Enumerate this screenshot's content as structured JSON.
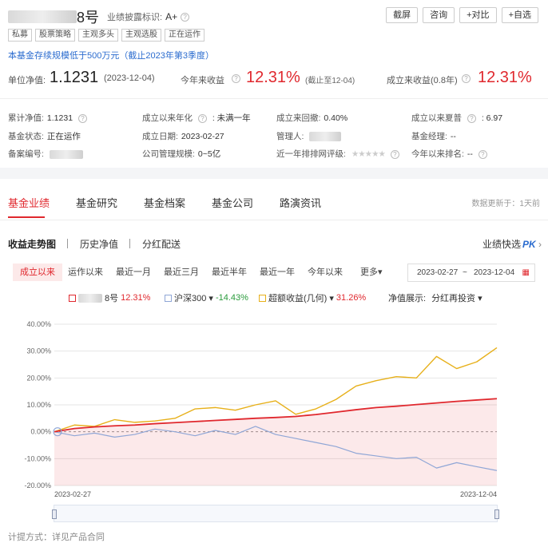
{
  "header": {
    "fund_name_visible": "8号",
    "disclosure_label": "业绩披露标识:",
    "disclosure_value": "A+",
    "buttons": [
      "截屏",
      "咨询",
      "+对比",
      "+自选"
    ],
    "tags": [
      "私募",
      "股票策略",
      "主观多头",
      "主观选股",
      "正在运作"
    ],
    "notice": "本基金存续规模低于500万元（截止2023年第3季度）"
  },
  "nav": {
    "unit_nav_label": "单位净值:",
    "unit_nav_value": "1.1231",
    "unit_nav_date": "(2023-12-04)",
    "ytd_label": "今年来收益",
    "ytd_value": "12.31%",
    "ytd_note": "(截止至12-04)",
    "since_label": "成立来收益(0.8年)",
    "since_value": "12.31%"
  },
  "info": [
    {
      "label": "累计净值:",
      "value": "1.1231"
    },
    {
      "label": "成立以来年化",
      "value": ": 未满一年"
    },
    {
      "label": "成立来回撤:",
      "value": "0.40%"
    },
    {
      "label": "成立以来夏普",
      "value": ": 6.97"
    },
    {
      "label": "基金状态:",
      "value": "正在运作"
    },
    {
      "label": "成立日期:",
      "value": "2023-02-27"
    },
    {
      "label": "管理人:",
      "value": ""
    },
    {
      "label": "基金经理:",
      "value": "--"
    },
    {
      "label": "备案编号:",
      "value": ""
    },
    {
      "label": "公司管理规模:",
      "value": "0~5亿"
    },
    {
      "label": "近一年排排网评级:",
      "value": "★★★★★"
    },
    {
      "label": "今年以来排名:",
      "value": "--"
    }
  ],
  "tabs": [
    "基金业绩",
    "基金研究",
    "基金档案",
    "基金公司",
    "路演资讯"
  ],
  "update_note": "数据更新于：1天前",
  "subtabs": [
    "收益走势图",
    "历史净值",
    "分红配送"
  ],
  "pk_label": "业绩快选",
  "pk_badge": "PK",
  "ranges": [
    "成立以来",
    "运作以来",
    "最近一月",
    "最近三月",
    "最近半年",
    "最近一年",
    "今年以来",
    "更多▾"
  ],
  "date_range": {
    "start": "2023-02-27",
    "sep": "~",
    "end": "2023-12-04"
  },
  "legend": {
    "fund_suffix": "8号",
    "fund_value": "12.31%",
    "index_name": "沪深300 ▾",
    "index_value": "-14.43%",
    "excess_name": "超额收益(几何) ▾",
    "excess_value": "31.26%",
    "display_label": "净值展示:",
    "display_value": "分红再投资 ▾"
  },
  "colors": {
    "fund": "#e0282e",
    "index": "#8fa6d6",
    "excess": "#e7b01a"
  },
  "chart_data": {
    "type": "line",
    "x_start": "2023-02-27",
    "x_end": "2023-12-04",
    "ylim": [
      -20,
      40
    ],
    "yticks": [
      "40.00%",
      "30.00%",
      "20.00%",
      "10.00%",
      "0.00%",
      "-10.00%",
      "-20.00%"
    ],
    "xticks": [
      "2023-02-27",
      "2023-12-04"
    ],
    "series": [
      {
        "values": [
          0,
          1.2,
          1.8,
          2.2,
          2.5,
          3.0,
          3.4,
          3.8,
          4.2,
          4.6,
          5.0,
          5.3,
          5.7,
          6.4,
          7.3,
          8.2,
          9.0,
          9.5,
          10.1,
          10.7,
          11.3,
          11.8,
          12.31
        ]
      },
      {
        "values": [
          0,
          -1.5,
          -0.5,
          -2.0,
          -1.0,
          1.0,
          0.0,
          -1.5,
          0.5,
          -1.0,
          2.0,
          -1.0,
          -2.5,
          -4.0,
          -5.5,
          -8.0,
          -9.0,
          -10.0,
          -9.5,
          -13.5,
          -11.5,
          -13.0,
          -14.43
        ]
      },
      {
        "values": [
          0,
          2.5,
          2.0,
          4.5,
          3.5,
          4.0,
          5.0,
          8.5,
          9.0,
          8.0,
          10.0,
          11.5,
          6.5,
          8.5,
          12.0,
          17.0,
          19.0,
          20.5,
          20.0,
          28.0,
          23.5,
          26.0,
          31.26
        ]
      }
    ]
  },
  "footer": "计提方式：详见产品合同"
}
